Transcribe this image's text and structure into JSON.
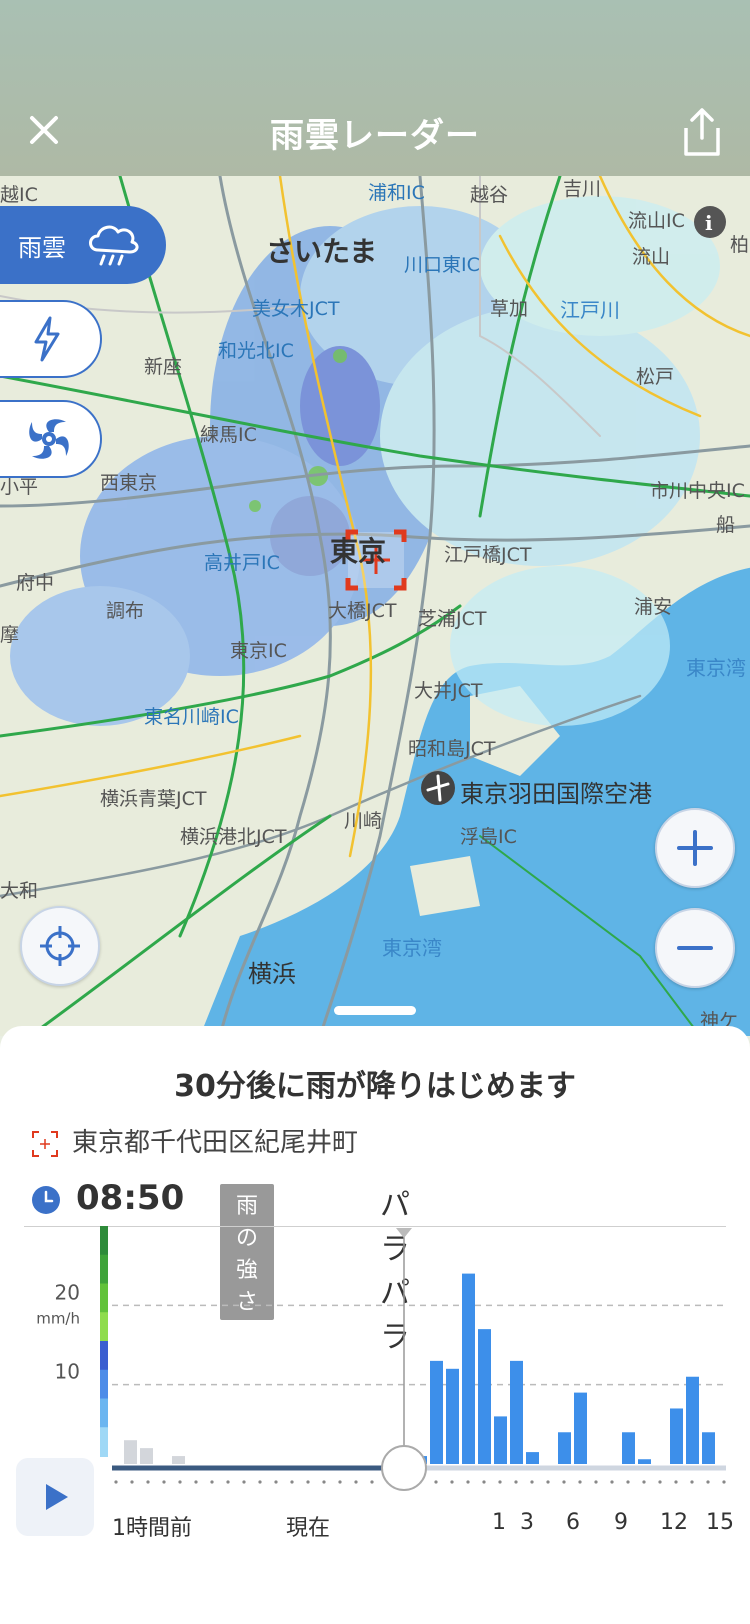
{
  "header": {
    "title": "雨雲レーダー"
  },
  "icons": {
    "close": "close-icon",
    "share": "share-icon",
    "rain_cloud": "rain-cloud-icon",
    "lightning": "lightning-icon",
    "typhoon": "typhoon-icon",
    "locate": "crosshair-icon",
    "zoom_in": "plus-icon",
    "zoom_out": "minus-icon",
    "play": "play-icon",
    "airport": "airport-icon",
    "info": "info-icon"
  },
  "layers": {
    "rain_label": "雨雲"
  },
  "map": {
    "labels": [
      {
        "text": "越IC",
        "cls": ""
      },
      {
        "text": "浦和IC",
        "cls": "blue"
      },
      {
        "text": "越谷",
        "cls": ""
      },
      {
        "text": "吉川",
        "cls": ""
      },
      {
        "text": "さいたま",
        "cls": "big"
      },
      {
        "text": "川口東IC",
        "cls": "blue"
      },
      {
        "text": "流山IC",
        "cls": ""
      },
      {
        "text": "流山",
        "cls": ""
      },
      {
        "text": "美女木JCT",
        "cls": "blue"
      },
      {
        "text": "草加",
        "cls": ""
      },
      {
        "text": "江戸川",
        "cls": "water"
      },
      {
        "text": "和光北IC",
        "cls": "blue"
      },
      {
        "text": "新座",
        "cls": ""
      },
      {
        "text": "松戸",
        "cls": ""
      },
      {
        "text": "練馬IC",
        "cls": ""
      },
      {
        "text": "西東京",
        "cls": ""
      },
      {
        "text": "市川中央IC",
        "cls": ""
      },
      {
        "text": "東京",
        "cls": "big"
      },
      {
        "text": "高井戸IC",
        "cls": "blue"
      },
      {
        "text": "江戸橋JCT",
        "cls": ""
      },
      {
        "text": "府中",
        "cls": ""
      },
      {
        "text": "調布",
        "cls": ""
      },
      {
        "text": "大橋JCT",
        "cls": ""
      },
      {
        "text": "芝浦JCT",
        "cls": ""
      },
      {
        "text": "浦安",
        "cls": ""
      },
      {
        "text": "東京IC",
        "cls": ""
      },
      {
        "text": "東京湾",
        "cls": "water"
      },
      {
        "text": "東名川崎IC",
        "cls": "blue"
      },
      {
        "text": "大井JCT",
        "cls": ""
      },
      {
        "text": "昭和島JCT",
        "cls": ""
      },
      {
        "text": "横浜青葉JCT",
        "cls": ""
      },
      {
        "text": "東京羽田国際空港",
        "cls": "city"
      },
      {
        "text": "横浜港北JCT",
        "cls": ""
      },
      {
        "text": "川崎",
        "cls": ""
      },
      {
        "text": "浮島IC",
        "cls": ""
      },
      {
        "text": "大和",
        "cls": ""
      },
      {
        "text": "東京湾",
        "cls": "water"
      },
      {
        "text": "横浜",
        "cls": "city"
      },
      {
        "text": "神ケ",
        "cls": ""
      },
      {
        "text": "船",
        "cls": ""
      },
      {
        "text": "柏",
        "cls": ""
      },
      {
        "text": "摩",
        "cls": ""
      },
      {
        "text": "小平",
        "cls": ""
      }
    ]
  },
  "panel": {
    "forecast": "30分後に雨が降りはじめます",
    "location": "東京都千代田区紀尾井町",
    "time": "08:50",
    "badge": "雨の強さ",
    "strength": "パラパラ"
  },
  "chart_data": {
    "type": "bar",
    "ylabel": "mm/h",
    "yticks": [
      10,
      20
    ],
    "ylim": [
      0,
      30
    ],
    "current_marker_index": 9,
    "x_tick_labels": [
      "1時間前",
      "現在",
      "1",
      "3",
      "6",
      "9",
      "12",
      "15"
    ],
    "past_values": [
      3,
      2,
      0,
      1,
      0,
      0,
      0,
      0,
      0
    ],
    "values": [
      0,
      1,
      13,
      12,
      24,
      17,
      6,
      13,
      1.5,
      0,
      4,
      9,
      0,
      0,
      4,
      0.6,
      0,
      7,
      11,
      4
    ],
    "colors": {
      "bar": "#3d8fea",
      "past": "#d3d6db",
      "accent": "#3b71c8"
    },
    "scale_colors": [
      "#2e8b3a",
      "#3fa33a",
      "#62c23a",
      "#8fdc4c",
      "#3b5ed0",
      "#4d8ce8",
      "#6bb5f0",
      "#9fd8f6"
    ]
  }
}
